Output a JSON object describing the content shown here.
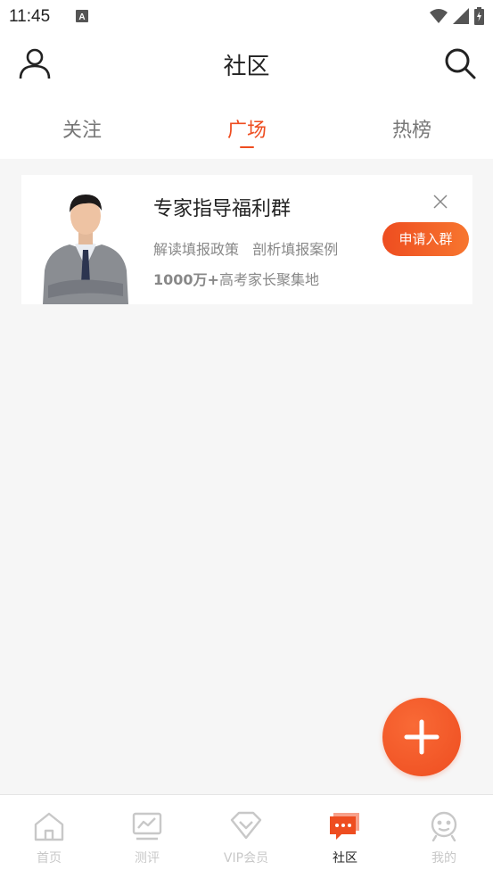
{
  "status_bar": {
    "time": "11:45"
  },
  "header": {
    "title": "社区"
  },
  "tabs": [
    {
      "label": "关注"
    },
    {
      "label": "广场"
    },
    {
      "label": "热榜"
    }
  ],
  "card": {
    "title": "专家指导福利群",
    "subtitle": "解读填报政策   剖析填报案例",
    "highlight_bold": "1000万+",
    "highlight_rest": "高考家长聚集地",
    "join_label": "申请入群"
  },
  "bottom_nav": [
    {
      "label": "首页",
      "icon": "home-icon"
    },
    {
      "label": "测评",
      "icon": "assessment-icon"
    },
    {
      "label": "VIP会员",
      "icon": "vip-icon"
    },
    {
      "label": "社区",
      "icon": "community-icon"
    },
    {
      "label": "我的",
      "icon": "profile-face-icon"
    }
  ],
  "colors": {
    "accent": "#ee4d20",
    "inactive": "#c8c8c8"
  }
}
